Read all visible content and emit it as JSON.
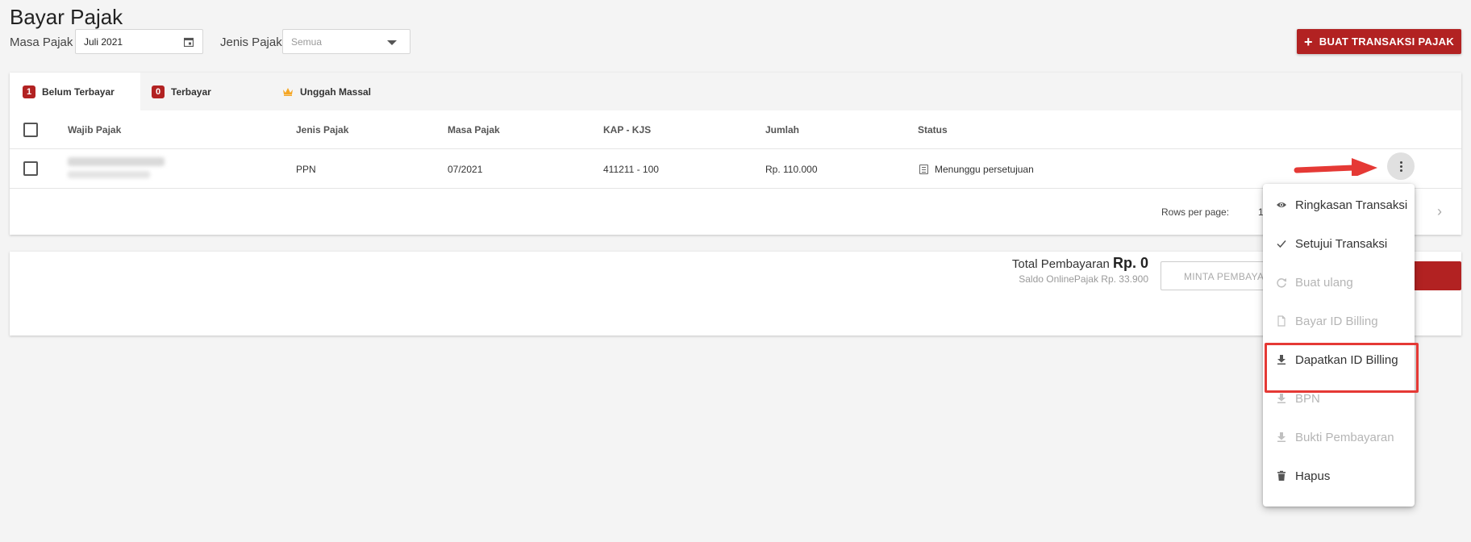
{
  "page": {
    "title": "Bayar Pajak"
  },
  "filters": {
    "masa_label": "Masa Pajak",
    "masa_value": "Juli 2021",
    "jenis_label": "Jenis Pajak",
    "jenis_placeholder": "Semua"
  },
  "create_button": {
    "label": "BUAT TRANSAKSI PAJAK"
  },
  "tabs": [
    {
      "badge": "1",
      "label": "Belum Terbayar",
      "active": true
    },
    {
      "badge": "0",
      "label": "Terbayar",
      "active": false
    },
    {
      "icon": "crown-icon",
      "label": "Unggah Massal",
      "active": false
    }
  ],
  "table": {
    "headers": [
      "Wajib Pajak",
      "Jenis Pajak",
      "Masa Pajak",
      "KAP - KJS",
      "Jumlah",
      "Status"
    ],
    "rows": [
      {
        "jenis": "PPN",
        "masa": "07/2021",
        "kap": "411211 - 100",
        "jumlah": "Rp. 110.000",
        "status": "Menunggu persetujuan"
      }
    ]
  },
  "pagination": {
    "rows_per_page_label": "Rows per page:",
    "rows_per_page_value": "1"
  },
  "summary": {
    "total_label": "Total Pembayaran",
    "total_value": "Rp. 0",
    "saldo": "Saldo OnlinePajak Rp. 33.900",
    "minta_label": "MINTA PEMBAYARAN"
  },
  "menu": {
    "items": [
      {
        "label": "Ringkasan Transaksi",
        "icon": "eye-icon",
        "disabled": false
      },
      {
        "label": "Setujui Transaksi",
        "icon": "check-icon",
        "disabled": false
      },
      {
        "label": "Buat ulang",
        "icon": "refresh-icon",
        "disabled": true
      },
      {
        "label": "Bayar ID Billing",
        "icon": "document-icon",
        "disabled": true
      },
      {
        "label": "Dapatkan ID Billing",
        "icon": "download-icon",
        "disabled": false,
        "highlighted": true
      },
      {
        "label": "BPN",
        "icon": "download-icon",
        "disabled": true
      },
      {
        "label": "Bukti Pembayaran",
        "icon": "download-icon",
        "disabled": true
      },
      {
        "label": "Hapus",
        "icon": "trash-icon",
        "disabled": false
      }
    ]
  },
  "colors": {
    "brand_red": "#b22222",
    "annotation_red": "#e53935",
    "crown_orange": "#f5a623"
  }
}
